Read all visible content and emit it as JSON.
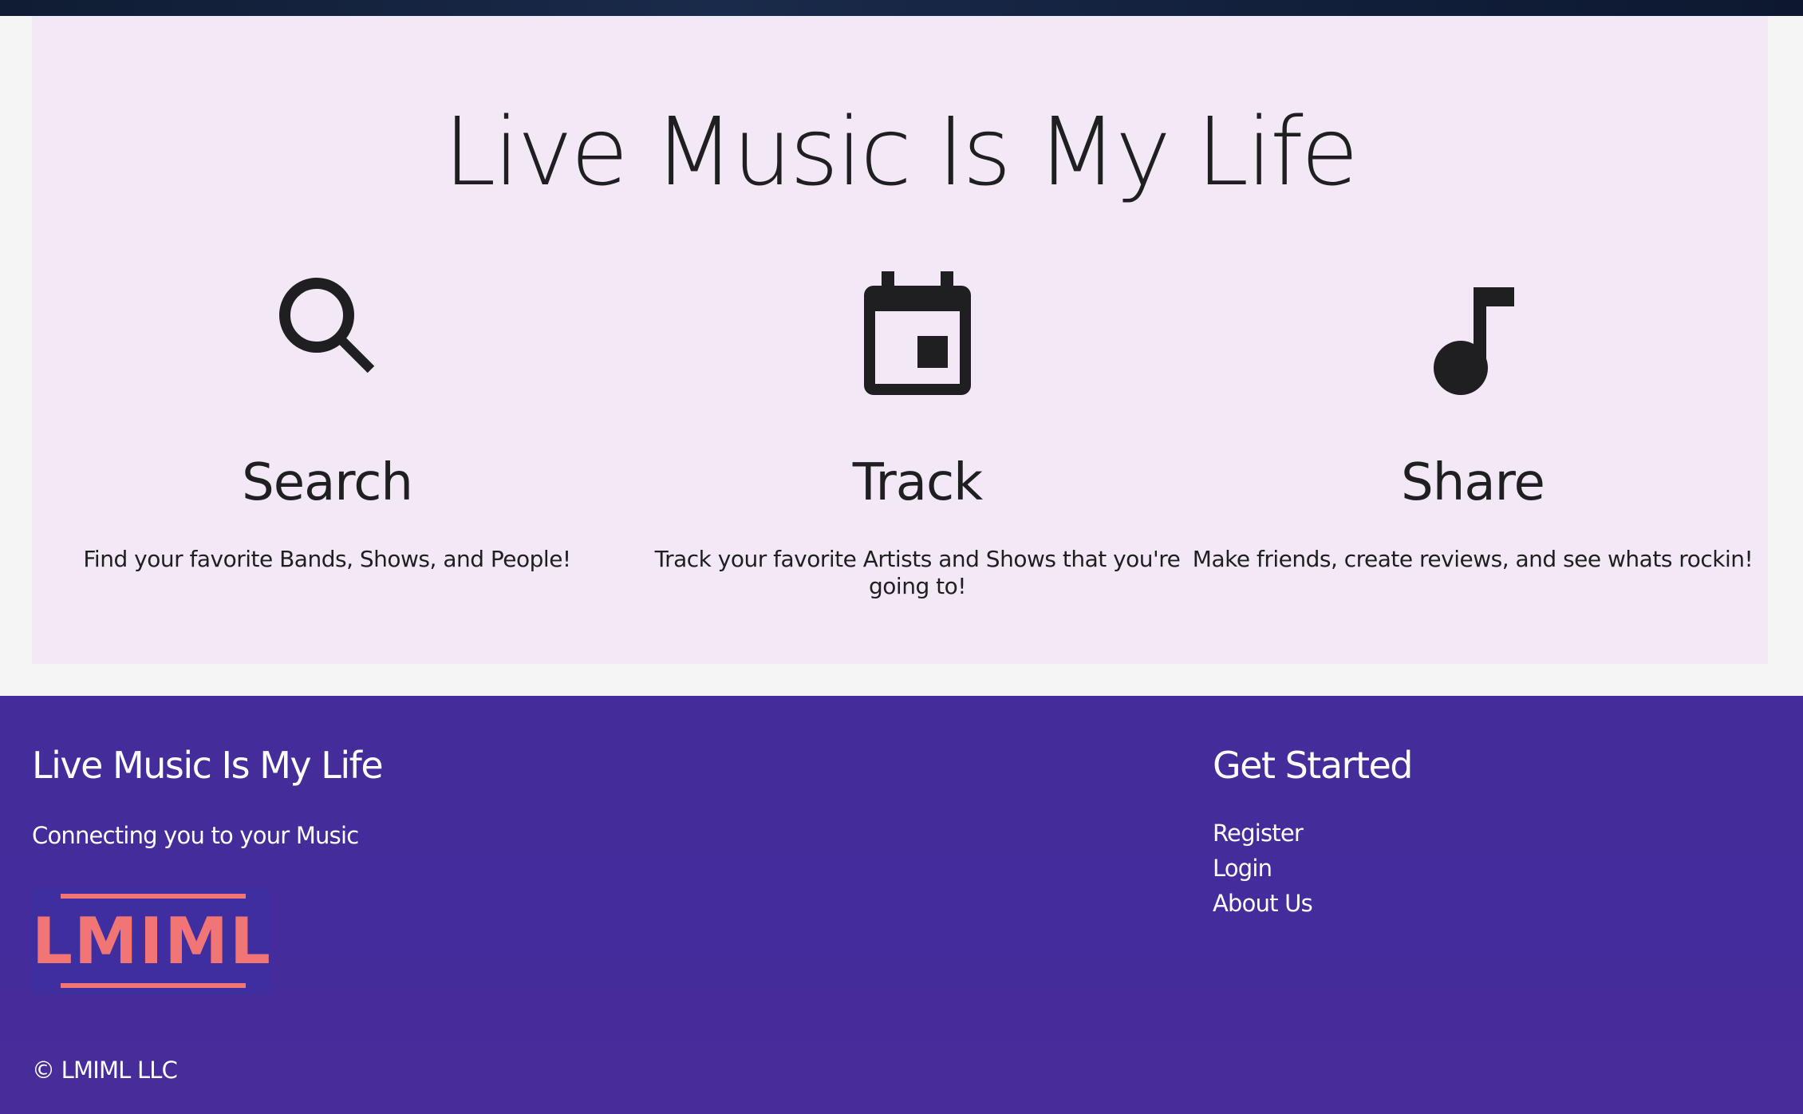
{
  "hero": {
    "title": "Live Music Is My Life",
    "features": [
      {
        "icon": "search-icon",
        "title": "Search",
        "description": "Find your favorite Bands, Shows, and People!"
      },
      {
        "icon": "calendar-icon",
        "title": "Track",
        "description": "Track your favorite Artists and Shows that you're going to!"
      },
      {
        "icon": "music-note-icon",
        "title": "Share",
        "description": "Make friends, create reviews, and see whats rockin!"
      }
    ]
  },
  "footer": {
    "brand": "Live Music Is My Life",
    "tagline": "Connecting you to your Music",
    "logo_text": "LMIML",
    "get_started_heading": "Get Started",
    "links": [
      "Register",
      "Login",
      "About Us"
    ],
    "copyright": "© LMIML LLC"
  },
  "colors": {
    "hero_background": "#f3e8f5",
    "footer_background": "#452c9c",
    "logo_accent": "#f27575",
    "text_dark": "#1f1f22"
  }
}
